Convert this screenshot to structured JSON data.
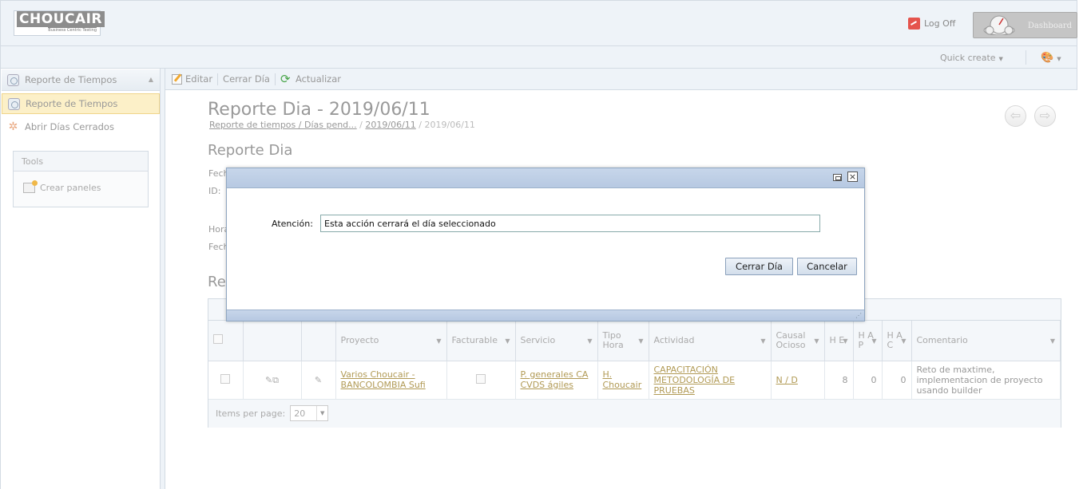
{
  "header": {
    "logo_text": "CHOUCAIR",
    "logo_tagline": "Business Centric Testing",
    "logoff_label": "Log Off",
    "dashboard_label": "Dashboard"
  },
  "subbar": {
    "quick_create_label": "Quick create"
  },
  "sidebar": {
    "header_label": "Reporte de Tiempos",
    "items": [
      {
        "label": "Reporte de Tiempos",
        "active": true,
        "icon": "clock-icon"
      },
      {
        "label": "Abrir Días Cerrados",
        "active": false,
        "icon": "gear-icon"
      }
    ],
    "tools": {
      "title": "Tools",
      "item_label": "Crear paneles"
    }
  },
  "toolbar": {
    "edit_label": "Editar",
    "close_day_label": "Cerrar Día",
    "refresh_label": "Actualizar"
  },
  "main": {
    "page_title": "Reporte Dia - 2019/06/11",
    "breadcrumb": {
      "link1": "Reporte de tiempos / Días pend...",
      "sep1": "/",
      "link2": "2019/06/11",
      "sep2": "/",
      "current": "2019/06/11"
    },
    "section_title": "Reporte Dia",
    "field_labels": [
      "Fech",
      "ID:",
      "Hora",
      "Fech"
    ],
    "section2_title": "Re"
  },
  "grid": {
    "columns": [
      {
        "label": "",
        "filter": false
      },
      {
        "label": "",
        "filter": false
      },
      {
        "label": "",
        "filter": false
      },
      {
        "label": "Proyecto",
        "filter": true
      },
      {
        "label": "Facturable",
        "filter": true
      },
      {
        "label": "Servicio",
        "filter": true
      },
      {
        "label": "Tipo Hora",
        "filter": true
      },
      {
        "label": "Actividad",
        "filter": true
      },
      {
        "label": "Causal Ocioso",
        "filter": true
      },
      {
        "label": "H E",
        "filter": true
      },
      {
        "label": "H A P",
        "filter": true
      },
      {
        "label": "H A C",
        "filter": true
      },
      {
        "label": "Comentario",
        "filter": true
      }
    ],
    "row": {
      "proyecto": "Varios Choucair - BANCOLOMBIA Sufi",
      "servicio": "P. generales CA CVDS ágiles",
      "tipo_hora": "H. Choucair",
      "actividad": "CAPACITACIÓN METODOLOGÍA DE PRUEBAS",
      "causal_ocioso": "N / D",
      "he": "8",
      "hap": "0",
      "hac": "0",
      "comentario": "Reto de maxtime, implementacion de proyecto usando builder"
    },
    "pager_label": "Items per page:",
    "page_size": "20"
  },
  "dialog": {
    "label": "Atención:",
    "message": "Esta acción cerrará el día seleccionado",
    "confirm_label": "Cerrar Día",
    "cancel_label": "Cancelar"
  }
}
